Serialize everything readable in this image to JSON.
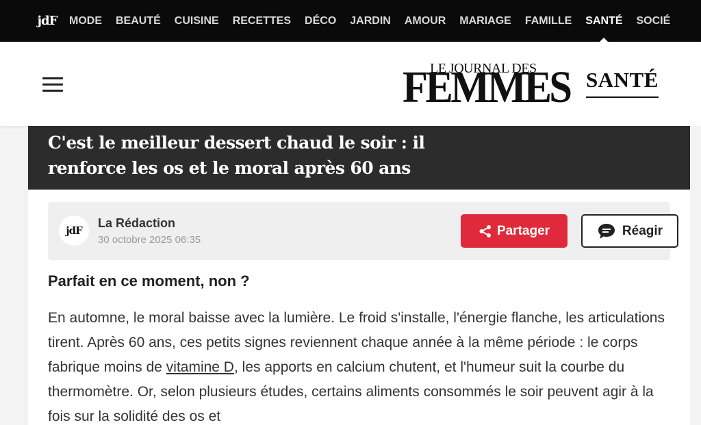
{
  "topnav": {
    "logo_text": "jdF",
    "categories": [
      {
        "label": "MODE",
        "active": false
      },
      {
        "label": "BEAUTÉ",
        "active": false
      },
      {
        "label": "CUISINE",
        "active": false
      },
      {
        "label": "RECETTES",
        "active": false
      },
      {
        "label": "DÉCO",
        "active": false
      },
      {
        "label": "JARDIN",
        "active": false
      },
      {
        "label": "AMOUR",
        "active": false
      },
      {
        "label": "MARIAGE",
        "active": false
      },
      {
        "label": "FAMILLE",
        "active": false
      },
      {
        "label": "SANTÉ",
        "active": true
      },
      {
        "label": "SOCIÉ",
        "active": false
      }
    ]
  },
  "header": {
    "logo_line1": "LE JOURNAL DES",
    "logo_line2": "FEMMES",
    "section": "SANTÉ"
  },
  "article": {
    "title": "C'est le meilleur dessert chaud le soir : il renforce les os et le moral après 60 ans",
    "author": "La Rédaction",
    "author_avatar_text": "jdF",
    "date": "30 octobre 2025 06:35",
    "share_label": "Partager",
    "react_label": "Réagir",
    "lead": "Parfait en ce moment, non ?",
    "body_before_link": "En automne, le moral baisse avec la lumière. Le froid s'installe, l'énergie flanche, les articulations tirent. Après 60 ans, ces petits signes reviennent chaque année à la même période : le corps fabrique moins de ",
    "body_link": "vitamine D",
    "body_after_link": ", les apports en calcium chutent, et l'humeur suit la courbe du thermomètre. Or, selon plusieurs études, certains aliments consommés le soir peuvent agir à la fois sur la solidité des os et"
  },
  "colors": {
    "topnav_bg": "#0a0a0a",
    "title_bg": "#2c2c2c",
    "share_red": "#e0293b",
    "byline_bg": "#efefef"
  },
  "icons": {
    "menu": "hamburger-menu-icon",
    "share": "share-icon",
    "react": "comment-bubble-icon"
  }
}
